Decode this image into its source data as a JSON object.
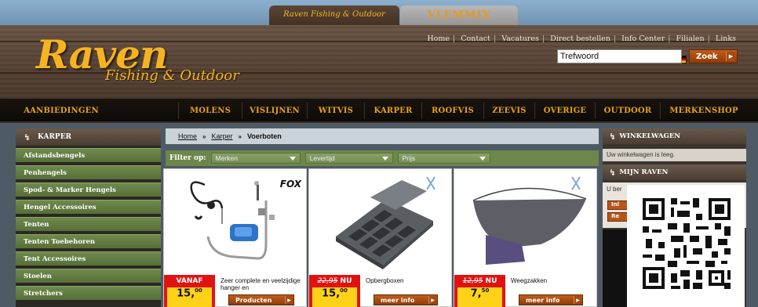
{
  "tabs": {
    "raven": "Raven Fishing & Outdoor",
    "vlemmix": "VLEMMIX"
  },
  "logo": {
    "main": "Raven",
    "sub": "Fishing & Outdoor"
  },
  "toplinks": [
    "Home",
    "Contact",
    "Vacatures",
    "Direct bestellen",
    "Info Center",
    "Filialen",
    "Links"
  ],
  "flags": [
    "flag-nl-icon",
    "flag-uk-icon",
    "flag-de-icon",
    "flag-cz-icon",
    "flag-pl-icon"
  ],
  "search": {
    "value": "Trefwoord",
    "button": "Zoek"
  },
  "nav": [
    "AANBIEDINGEN",
    "MOLENS",
    "VISLIJNEN",
    "WITVIS",
    "KARPER",
    "ROOFVIS",
    "ZEEVIS",
    "OVERIGE",
    "OUTDOOR",
    "MERKENSHOP"
  ],
  "sidebar": {
    "title": "KARPER",
    "items": [
      "Afstandsbengels",
      "Penhengels",
      "Spod- & Marker Hengels",
      "Hengel Accessoires",
      "Tenten",
      "Tenten Toebehoren",
      "Tent Accessoires",
      "Stoelen",
      "Stretchers"
    ]
  },
  "breadcrumb": {
    "home": "Home",
    "sep": "»",
    "cat": "Karper",
    "current": "Voerboten"
  },
  "filter": {
    "label": "Filter op:",
    "selects": [
      "Merken",
      "Levertijd",
      "Prijs"
    ]
  },
  "products": [
    {
      "price_label": "VANAF",
      "price_old": "",
      "price": "15,",
      "price_cents": "00",
      "name": "Zeer complete en veelzijdige hanger en",
      "button": "Producten",
      "brand": "FOX"
    },
    {
      "price_label": "NU",
      "price_old": "22,95",
      "price": "15,",
      "price_cents": "00",
      "name": "Opbergboxen",
      "button": "meer info",
      "brand": ""
    },
    {
      "price_label": "NU",
      "price_old": "12,95",
      "price": "7,",
      "price_cents": "50",
      "name": "Weegzakken",
      "button": "meer info",
      "brand": ""
    }
  ],
  "right": {
    "cart_title": "WINKELWAGEN",
    "cart_empty": "Uw winkelwagen is leeg.",
    "account_title": "MIJN RAVEN",
    "login_text": "U ber",
    "btn1": "Inl",
    "btn2": "Re"
  },
  "colors": {
    "accent": "#e8a11a",
    "green": "#6c874a",
    "price_red": "#e01313",
    "price_yellow": "#ffd21a"
  }
}
